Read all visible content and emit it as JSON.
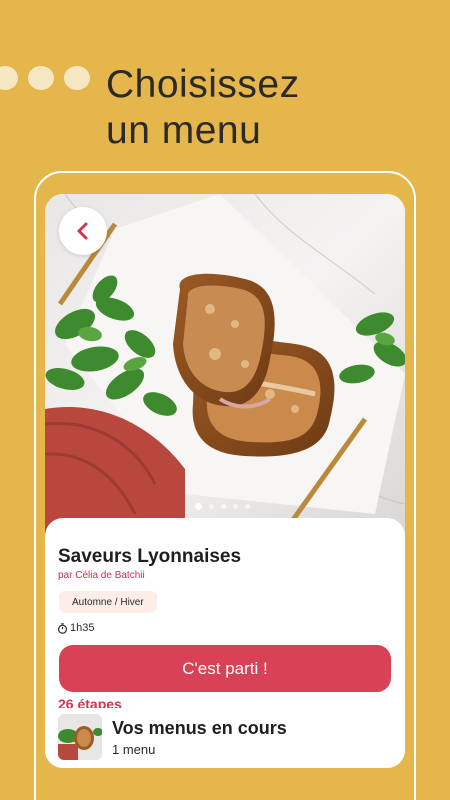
{
  "headline": {
    "line1": "Choisissez",
    "line2": "un menu"
  },
  "recipe": {
    "title": "Saveurs Lyonnaises",
    "author": "par Célia de Batchii",
    "tag": "Automne / Hiver",
    "duration": "1h35",
    "cta": "C'est parti !",
    "steps": "26 étapes"
  },
  "pager": {
    "count": 5,
    "active": 1
  },
  "current_menus": {
    "title": "Vos menus en cours",
    "subtitle": "1 menu"
  },
  "colors": {
    "background": "#E5B64C",
    "accent": "#D94256",
    "tag_bg": "#FDEDE8"
  },
  "icons": {
    "back": "chevron-left-icon",
    "timer": "timer-icon"
  }
}
